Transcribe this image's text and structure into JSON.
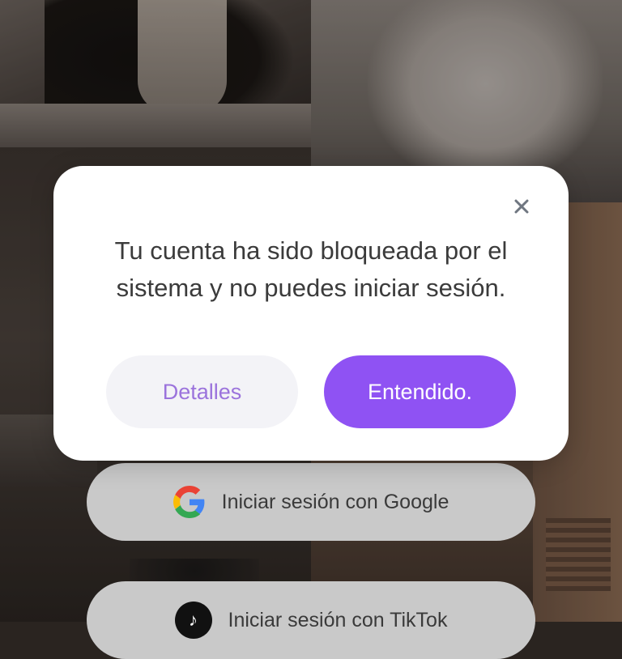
{
  "dialog": {
    "message": "Tu cuenta ha sido bloqueada por el sistema y no puedes iniciar sesión.",
    "details_label": "Detalles",
    "ok_label": "Entendido.",
    "close_icon": "close-icon"
  },
  "signin": {
    "google_label": "Iniciar sesión con Google",
    "google_icon": "google-icon",
    "tiktok_label": "Iniciar sesión con TikTok",
    "tiktok_icon": "tiktok-icon"
  },
  "colors": {
    "accent": "#8f52f3",
    "details_text": "#9b73dc",
    "details_bg": "#f3f3f7",
    "signin_bg": "#c9c9c9"
  }
}
